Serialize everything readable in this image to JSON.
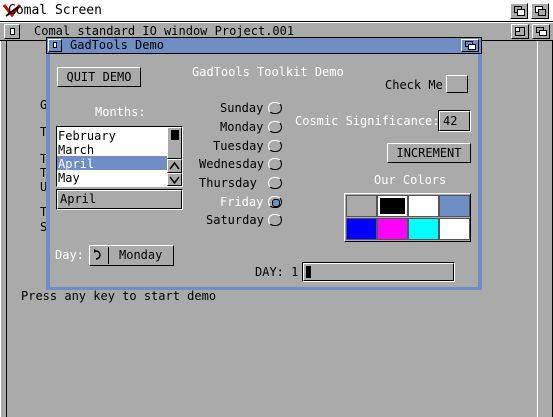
{
  "screen": {
    "title": "Comal Screen"
  },
  "background_window": {
    "title": "Comal standard IO window  Project.001",
    "left_letters": [
      "G",
      "T",
      "T",
      "T",
      "U",
      "T",
      "S"
    ],
    "prompt": "Press any key to start demo"
  },
  "demo_window": {
    "title": "GadTools Demo",
    "heading": "GadTools Toolkit Demo",
    "quit_label": "QUIT DEMO",
    "months_label": "Months:",
    "months": [
      "February",
      "March",
      "April",
      "May"
    ],
    "selected_month": "April",
    "month_field_value": "April",
    "weekdays": [
      "Sunday",
      "Monday",
      "Tuesday",
      "Wednesday",
      "Thursday",
      "Friday",
      "Saturday"
    ],
    "selected_weekday": "Friday",
    "checkbox_label": "Check Me",
    "cosmic_label": "Cosmic Significance:",
    "cosmic_value": "42",
    "increment_label": "INCREMENT",
    "colors_label": "Our Colors",
    "colors": [
      "#aaaaaa",
      "#000000",
      "#ffffff",
      "#6f8fc4",
      "#0000ff",
      "#ff00ff",
      "#00ffff",
      "#ffffff"
    ],
    "day_label": "Day:",
    "day_cycle_value": "Monday",
    "day_slider_label": "DAY: 1",
    "day_slider_level": 1
  }
}
